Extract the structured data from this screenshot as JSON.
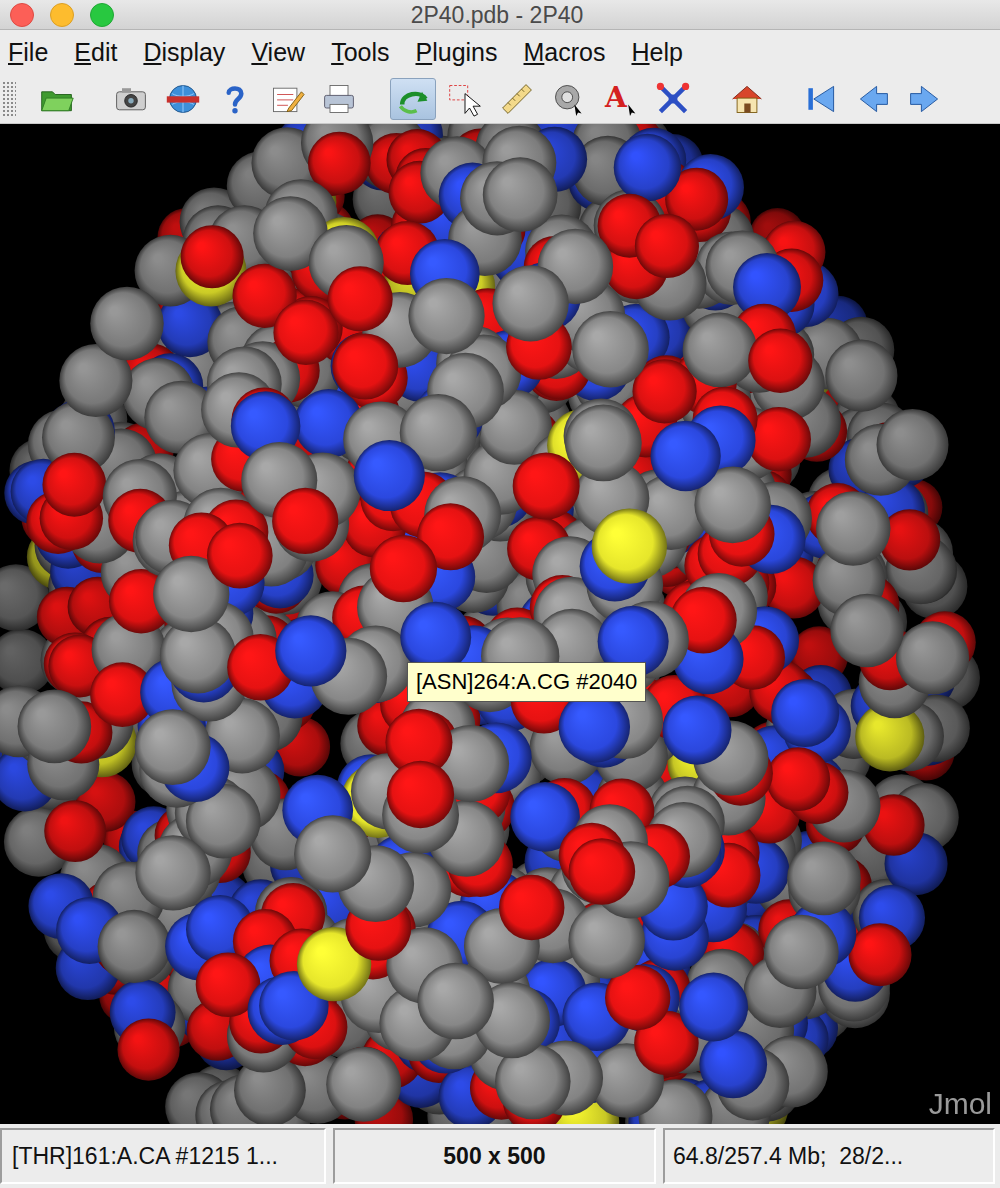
{
  "window": {
    "title": "2P40.pdb - 2P40"
  },
  "menu": [
    "File",
    "Edit",
    "Display",
    "View",
    "Tools",
    "Plugins",
    "Macros",
    "Help"
  ],
  "toolbar": [
    {
      "selected": false
    },
    {
      "selected": false
    },
    {
      "selected": false
    },
    {
      "selected": false
    },
    {
      "selected": false
    },
    {
      "selected": false
    },
    {
      "selected": true
    },
    {
      "selected": false
    },
    {
      "selected": false
    },
    {
      "selected": false
    },
    {
      "selected": false,
      "glyph": "A"
    },
    {
      "selected": false
    },
    {
      "selected": false
    },
    {
      "selected": false
    },
    {
      "selected": false
    },
    {
      "selected": false
    }
  ],
  "viewer": {
    "tooltip": "[ASN]264:A.CG #2040",
    "watermark": "Jmol"
  },
  "status_bar": [
    "[THR]161:A.CA #1215 1...",
    "500 x 500",
    "64.8/257.4 Mb;  28/2..."
  ]
}
